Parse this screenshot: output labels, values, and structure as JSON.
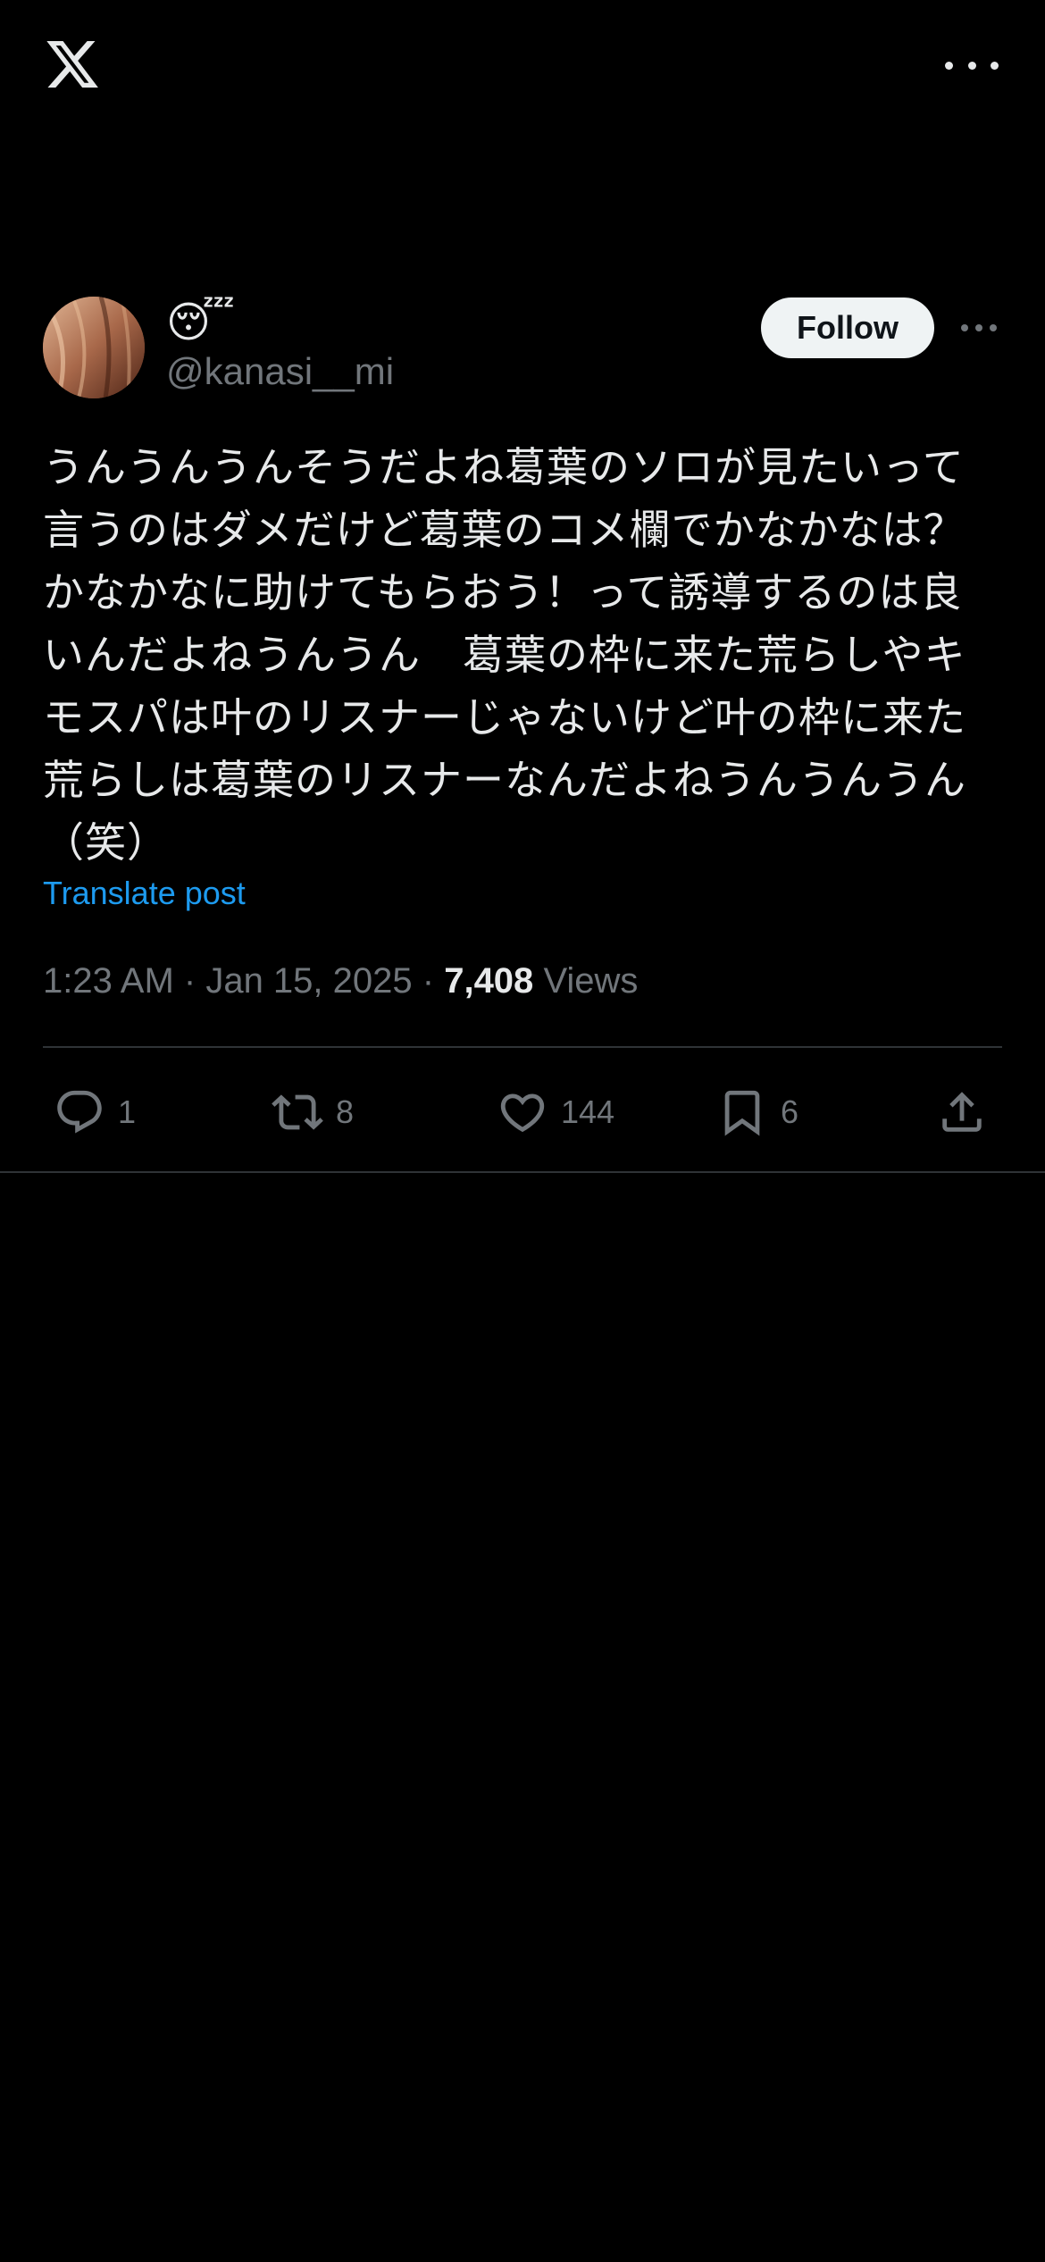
{
  "top_bar": {
    "logo_icon": "x-logo-icon",
    "more_icon": "more-horizontal-icon"
  },
  "author": {
    "emoji_name": "😴",
    "handle": "@kanasi__mi",
    "follow_label": "Follow"
  },
  "post": {
    "text": "うんうんうんそうだよね葛葉のソロが見たいって言うのはダメだけど葛葉のコメ欄でかなかなは？かなかなに助けてもらおう！って誘導するのは良いんだよねうんうん　葛葉の枠に来た荒らしやキモスパは叶のリスナーじゃないけど叶の枠に来た荒らしは葛葉のリスナーなんだよねうんうんうん（笑）",
    "translate_label": "Translate post",
    "time": "1:23 AM",
    "date": "Jan 15, 2025",
    "views_count": "7,408",
    "views_label": "Views"
  },
  "actions": {
    "replies": "1",
    "reposts": "8",
    "likes": "144",
    "bookmarks": "6"
  },
  "colors": {
    "background": "#000000",
    "text": "#e7e9ea",
    "muted": "#71767b",
    "accent": "#1d9bf0",
    "divider": "#2f3336"
  }
}
